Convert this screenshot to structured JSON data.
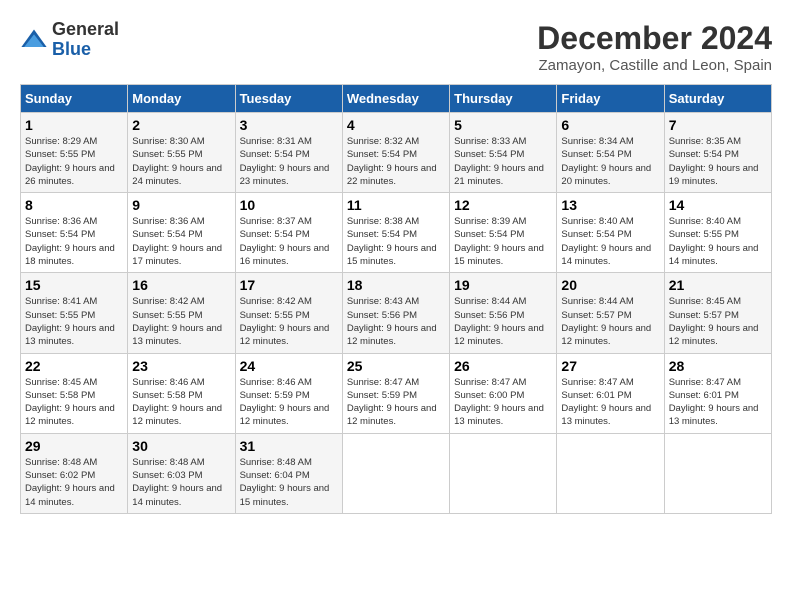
{
  "logo": {
    "general": "General",
    "blue": "Blue"
  },
  "title": "December 2024",
  "location": "Zamayon, Castille and Leon, Spain",
  "days_header": [
    "Sunday",
    "Monday",
    "Tuesday",
    "Wednesday",
    "Thursday",
    "Friday",
    "Saturday"
  ],
  "weeks": [
    [
      {
        "day": "1",
        "sunrise": "8:29 AM",
        "sunset": "5:55 PM",
        "daylight": "9 hours and 26 minutes."
      },
      {
        "day": "2",
        "sunrise": "8:30 AM",
        "sunset": "5:55 PM",
        "daylight": "9 hours and 24 minutes."
      },
      {
        "day": "3",
        "sunrise": "8:31 AM",
        "sunset": "5:54 PM",
        "daylight": "9 hours and 23 minutes."
      },
      {
        "day": "4",
        "sunrise": "8:32 AM",
        "sunset": "5:54 PM",
        "daylight": "9 hours and 22 minutes."
      },
      {
        "day": "5",
        "sunrise": "8:33 AM",
        "sunset": "5:54 PM",
        "daylight": "9 hours and 21 minutes."
      },
      {
        "day": "6",
        "sunrise": "8:34 AM",
        "sunset": "5:54 PM",
        "daylight": "9 hours and 20 minutes."
      },
      {
        "day": "7",
        "sunrise": "8:35 AM",
        "sunset": "5:54 PM",
        "daylight": "9 hours and 19 minutes."
      }
    ],
    [
      {
        "day": "8",
        "sunrise": "8:36 AM",
        "sunset": "5:54 PM",
        "daylight": "9 hours and 18 minutes."
      },
      {
        "day": "9",
        "sunrise": "8:36 AM",
        "sunset": "5:54 PM",
        "daylight": "9 hours and 17 minutes."
      },
      {
        "day": "10",
        "sunrise": "8:37 AM",
        "sunset": "5:54 PM",
        "daylight": "9 hours and 16 minutes."
      },
      {
        "day": "11",
        "sunrise": "8:38 AM",
        "sunset": "5:54 PM",
        "daylight": "9 hours and 15 minutes."
      },
      {
        "day": "12",
        "sunrise": "8:39 AM",
        "sunset": "5:54 PM",
        "daylight": "9 hours and 15 minutes."
      },
      {
        "day": "13",
        "sunrise": "8:40 AM",
        "sunset": "5:54 PM",
        "daylight": "9 hours and 14 minutes."
      },
      {
        "day": "14",
        "sunrise": "8:40 AM",
        "sunset": "5:55 PM",
        "daylight": "9 hours and 14 minutes."
      }
    ],
    [
      {
        "day": "15",
        "sunrise": "8:41 AM",
        "sunset": "5:55 PM",
        "daylight": "9 hours and 13 minutes."
      },
      {
        "day": "16",
        "sunrise": "8:42 AM",
        "sunset": "5:55 PM",
        "daylight": "9 hours and 13 minutes."
      },
      {
        "day": "17",
        "sunrise": "8:42 AM",
        "sunset": "5:55 PM",
        "daylight": "9 hours and 12 minutes."
      },
      {
        "day": "18",
        "sunrise": "8:43 AM",
        "sunset": "5:56 PM",
        "daylight": "9 hours and 12 minutes."
      },
      {
        "day": "19",
        "sunrise": "8:44 AM",
        "sunset": "5:56 PM",
        "daylight": "9 hours and 12 minutes."
      },
      {
        "day": "20",
        "sunrise": "8:44 AM",
        "sunset": "5:57 PM",
        "daylight": "9 hours and 12 minutes."
      },
      {
        "day": "21",
        "sunrise": "8:45 AM",
        "sunset": "5:57 PM",
        "daylight": "9 hours and 12 minutes."
      }
    ],
    [
      {
        "day": "22",
        "sunrise": "8:45 AM",
        "sunset": "5:58 PM",
        "daylight": "9 hours and 12 minutes."
      },
      {
        "day": "23",
        "sunrise": "8:46 AM",
        "sunset": "5:58 PM",
        "daylight": "9 hours and 12 minutes."
      },
      {
        "day": "24",
        "sunrise": "8:46 AM",
        "sunset": "5:59 PM",
        "daylight": "9 hours and 12 minutes."
      },
      {
        "day": "25",
        "sunrise": "8:47 AM",
        "sunset": "5:59 PM",
        "daylight": "9 hours and 12 minutes."
      },
      {
        "day": "26",
        "sunrise": "8:47 AM",
        "sunset": "6:00 PM",
        "daylight": "9 hours and 13 minutes."
      },
      {
        "day": "27",
        "sunrise": "8:47 AM",
        "sunset": "6:01 PM",
        "daylight": "9 hours and 13 minutes."
      },
      {
        "day": "28",
        "sunrise": "8:47 AM",
        "sunset": "6:01 PM",
        "daylight": "9 hours and 13 minutes."
      }
    ],
    [
      {
        "day": "29",
        "sunrise": "8:48 AM",
        "sunset": "6:02 PM",
        "daylight": "9 hours and 14 minutes."
      },
      {
        "day": "30",
        "sunrise": "8:48 AM",
        "sunset": "6:03 PM",
        "daylight": "9 hours and 14 minutes."
      },
      {
        "day": "31",
        "sunrise": "8:48 AM",
        "sunset": "6:04 PM",
        "daylight": "9 hours and 15 minutes."
      },
      null,
      null,
      null,
      null
    ]
  ]
}
